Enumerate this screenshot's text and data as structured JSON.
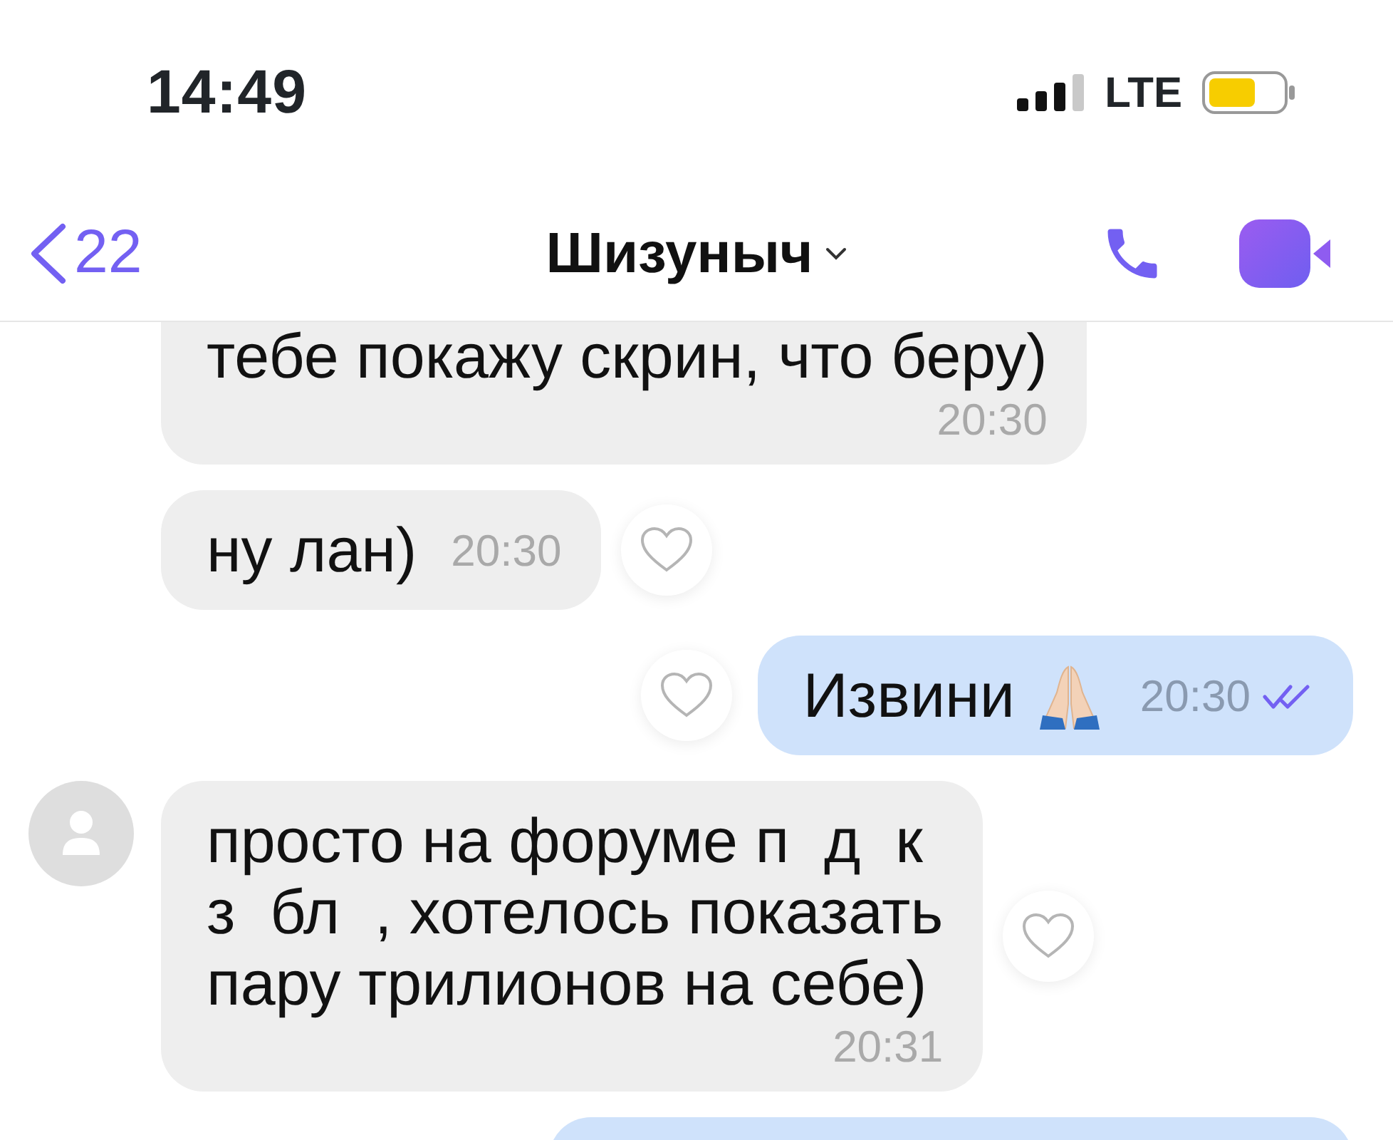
{
  "status_bar": {
    "time": "14:49",
    "network": "LTE"
  },
  "header": {
    "back_count": "22",
    "contact_name": "Шизуныч"
  },
  "messages": [
    {
      "kind": "incoming",
      "cut_top": true,
      "avatar": false,
      "lines": [
        "тебе покажу скрин, что беру)"
      ],
      "time": "20:30"
    },
    {
      "kind": "incoming",
      "cut_top": false,
      "avatar": false,
      "lines": [
        "ну лан)"
      ],
      "time": "20:30",
      "inline_time": true
    },
    {
      "kind": "outgoing",
      "cut_top": false,
      "lines": [
        "Извини"
      ],
      "has_emoji": true,
      "time": "20:30",
      "inline_time": true,
      "read": true
    },
    {
      "kind": "incoming",
      "cut_top": false,
      "avatar": true,
      "lines": [
        "просто на форуме п  д  к",
        "з  бл  , хотелось показать",
        "пару трилионов на себе)"
      ],
      "time": "20:31"
    },
    {
      "kind": "outgoing",
      "cut_top": false
    }
  ]
}
